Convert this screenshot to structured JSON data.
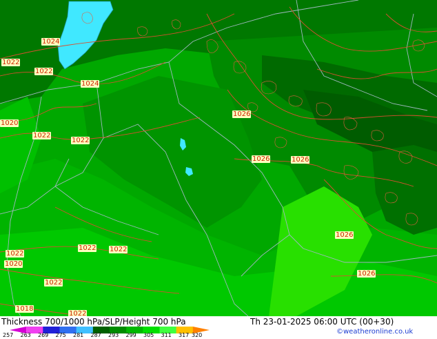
{
  "footer": {
    "title": "Thickness 700/1000 hPa/SLP/Height 700 hPa",
    "datetime": "Th 23-01-2025 06:00 UTC (00+30)",
    "credit": "©weatheronline.co.uk"
  },
  "legend": {
    "ticks": [
      "257",
      "263",
      "269",
      "275",
      "281",
      "287",
      "293",
      "299",
      "305",
      "311",
      "317",
      "320"
    ],
    "colors": [
      "#d400d4",
      "#f040f0",
      "#2020d8",
      "#3070f0",
      "#40c0ff",
      "#006000",
      "#008c00",
      "#00b800",
      "#00e000",
      "#40ff40",
      "#ffc000",
      "#ff8000"
    ]
  },
  "map": {
    "pressure_labels": [
      "1024",
      "1022",
      "1022",
      "1024",
      "1020",
      "1022",
      "1022",
      "1026",
      "1026",
      "1026",
      "1026",
      "1022",
      "1022",
      "1022",
      "1020",
      "1022",
      "1018",
      "1022",
      "1026"
    ],
    "colors": {
      "water": "#40e8ff",
      "contour": "#d85030",
      "border": "#a0b8c0"
    }
  }
}
